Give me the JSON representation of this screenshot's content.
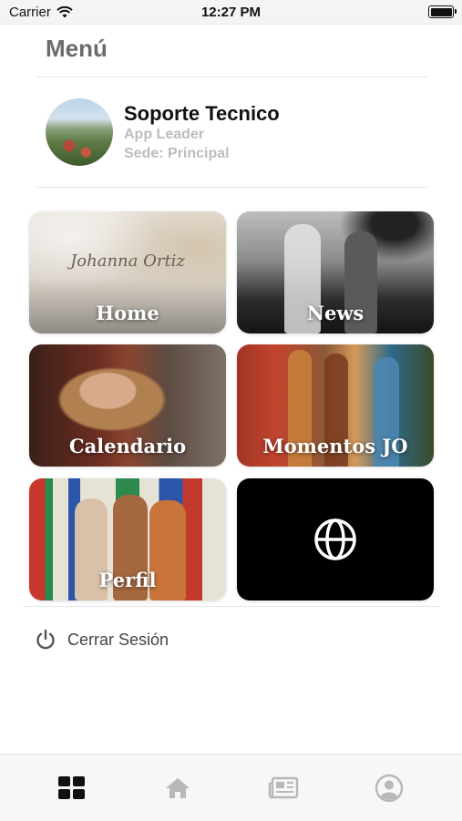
{
  "status_bar": {
    "carrier": "Carrier",
    "time": "12:27 PM"
  },
  "menu": {
    "title": "Menú"
  },
  "profile": {
    "name": "Soporte Tecnico",
    "role": "App Leader",
    "site": "Sede: Principal"
  },
  "tiles": [
    {
      "label": "Home",
      "icon": "home-image"
    },
    {
      "label": "News",
      "icon": "news-image"
    },
    {
      "label": "Calendario",
      "icon": "calendar-image"
    },
    {
      "label": "Momentos JO",
      "icon": "moments-image"
    },
    {
      "label": "Perfil",
      "icon": "profile-image"
    },
    {
      "label": "",
      "icon": "globe-icon"
    }
  ],
  "home_tile_script": "Johanna Ortiz",
  "logout": {
    "label": "Cerrar Sesión",
    "icon": "power-icon"
  },
  "tab_bar": {
    "items": [
      {
        "name": "menu",
        "icon": "grid-icon",
        "active": true
      },
      {
        "name": "home",
        "icon": "home-icon",
        "active": false
      },
      {
        "name": "news",
        "icon": "newspaper-icon",
        "active": false
      },
      {
        "name": "profile",
        "icon": "user-circle-icon",
        "active": false
      }
    ]
  },
  "colors": {
    "active_tab": "#111111",
    "inactive_tab": "#b8b8b8",
    "muted_text": "#bdbdbd"
  }
}
